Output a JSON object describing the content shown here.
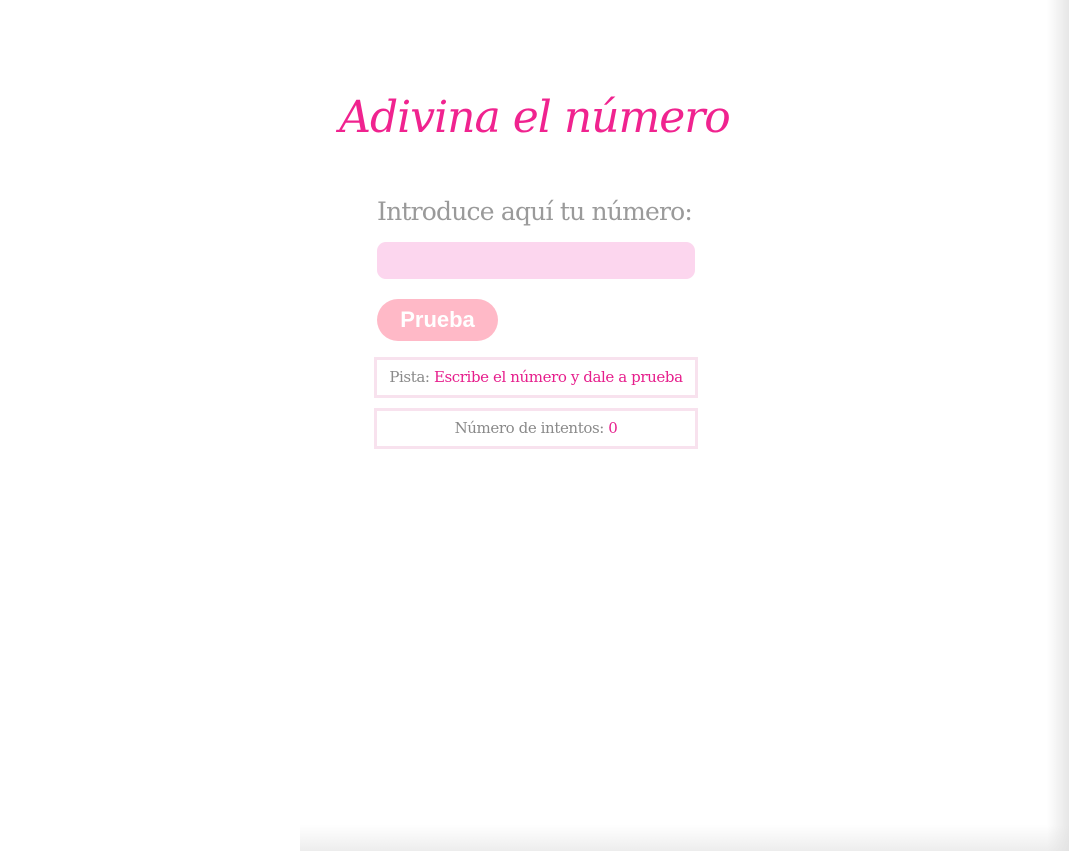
{
  "page": {
    "title": "Adivina el número"
  },
  "form": {
    "prompt_label": "Introduce aquí tu número:",
    "input_value": "",
    "input_placeholder": "",
    "try_button_label": "Prueba"
  },
  "hint": {
    "label": "Pista:",
    "value": "Escribe el número y dale a prueba"
  },
  "attempts": {
    "label": "Número de intentos:",
    "value": "0"
  },
  "colors": {
    "title": "#f0238f",
    "prompt": "#9a9a9a",
    "input_background": "#fcd6ee",
    "button_background": "#ffb9c7",
    "button_text": "#ffffff",
    "box_border": "#f8e2ee",
    "value_text": "#e61e8c",
    "label_text": "#8a8a8a"
  }
}
